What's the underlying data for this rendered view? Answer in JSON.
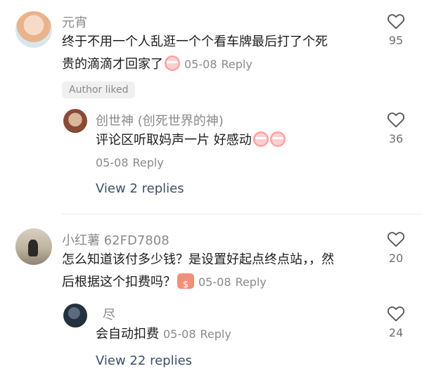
{
  "comments": [
    {
      "username": "元宵",
      "text_line1": "终于不用一个人乱逛一个个看车牌最后打了个死",
      "text_line2": "贵的滴滴才回家了",
      "date": "05-08",
      "reply_label": "Reply",
      "badge": "Author liked",
      "likes": "95",
      "replies": [
        {
          "username": "创世神 (创死世界的神)",
          "text": "评论区听取妈声一片  好感动",
          "date": "05-08",
          "reply_label": "Reply",
          "likes": "36"
        }
      ],
      "view_replies": "View 2 replies"
    },
    {
      "username": "小红薯 62FD7808",
      "text_line1": "怎么知道该付多少钱？是设置好起点终点站，，然",
      "text_line2": "后根据这个扣费吗？",
      "date": "05-08",
      "reply_label": "Reply",
      "likes": "20",
      "replies": [
        {
          "username": "尽",
          "text": "会自动扣费",
          "date": "05-08",
          "reply_label": "Reply",
          "likes": "24"
        }
      ],
      "view_replies": "View 22 replies"
    }
  ],
  "icons": {
    "like": "heart-outline-icon",
    "cry_emoji": "crying-emoji-icon",
    "money_emoji": "money-emoji-icon"
  },
  "colors": {
    "secondary_text": "#8a8a8a",
    "link_text": "#3f4f6b",
    "primary_text": "#1c1c1c"
  }
}
